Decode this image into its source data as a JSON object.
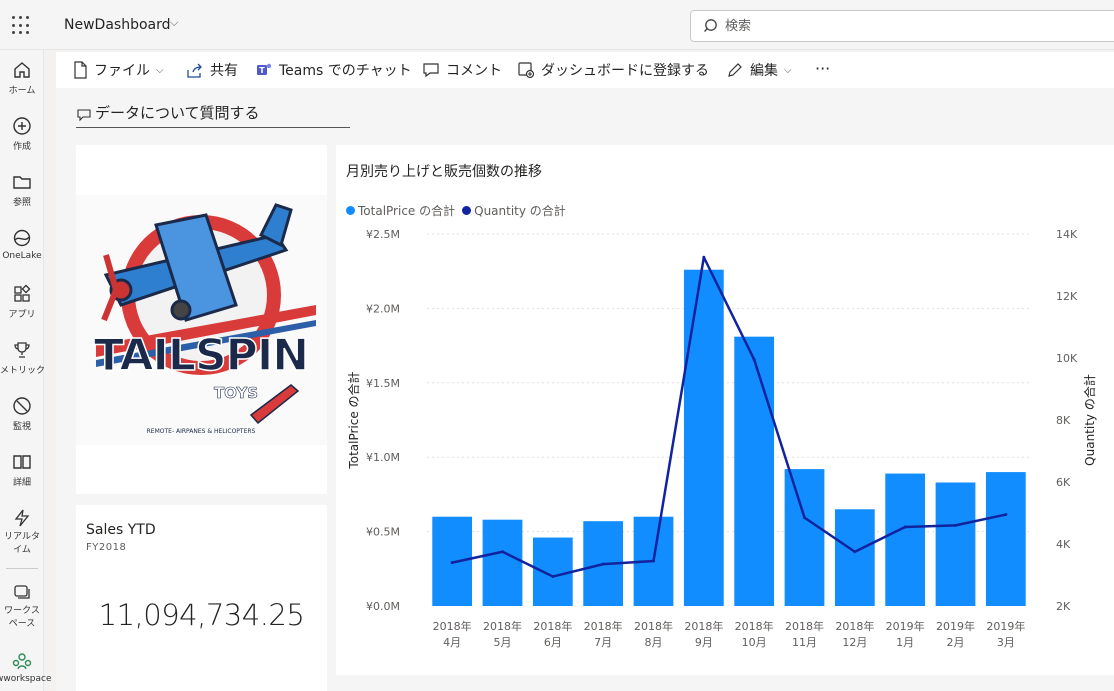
{
  "topbar": {
    "app_name": "NewDashboard",
    "search_placeholder": "検索"
  },
  "leftnav": {
    "items": [
      {
        "label": "ホーム",
        "icon": "home-icon"
      },
      {
        "label": "作成",
        "icon": "create-icon"
      },
      {
        "label": "参照",
        "icon": "browse-icon"
      },
      {
        "label": "OneLake",
        "icon": "onelake-icon"
      },
      {
        "label": "アプリ",
        "icon": "apps-icon"
      },
      {
        "label": "メトリック",
        "icon": "trophy-icon"
      },
      {
        "label": "監視",
        "icon": "monitor-icon"
      },
      {
        "label": "詳細",
        "icon": "learn-icon"
      },
      {
        "label": "リアルタイム",
        "icon": "realtime-icon"
      },
      {
        "label": "ワークスペース",
        "icon": "workspaces-icon"
      },
      {
        "label": "twworkspace",
        "icon": "workspace-group-icon"
      }
    ]
  },
  "toolbar": {
    "file": "ファイル",
    "share": "共有",
    "teams": "Teams でのチャット",
    "comment": "コメント",
    "pin": "ダッシュボードに登録する",
    "edit": "編集",
    "more": "···"
  },
  "qa": {
    "label": "データについて質問する"
  },
  "logo": {
    "text": "TAILSPIN",
    "sub": "TOYS",
    "tagline": "REMOTE-  AIRPANES & HELICOPTERS"
  },
  "ytd": {
    "title": "Sales YTD",
    "subtitle": "FY2018",
    "value": "11,094,734.25"
  },
  "chart": {
    "title": "月別売り上げと販売個数の推移",
    "legend": [
      {
        "name": "TotalPrice の合計",
        "color": "#118DFF"
      },
      {
        "name": "Quantity の合計",
        "color": "#12239E"
      }
    ],
    "y_left_label": "TotalPrice の合計",
    "y_right_label": "Quantity の合計",
    "y_left_ticks": [
      "¥0.0M",
      "¥0.5M",
      "¥1.0M",
      "¥1.5M",
      "¥2.0M",
      "¥2.5M"
    ],
    "y_right_ticks": [
      "2K",
      "4K",
      "6K",
      "8K",
      "10K",
      "12K",
      "14K"
    ]
  },
  "chart_data": {
    "type": "bar",
    "categories": [
      [
        "2018年",
        "4月"
      ],
      [
        "2018年",
        "5月"
      ],
      [
        "2018年",
        "6月"
      ],
      [
        "2018年",
        "7月"
      ],
      [
        "2018年",
        "8月"
      ],
      [
        "2018年",
        "9月"
      ],
      [
        "2018年",
        "10月"
      ],
      [
        "2018年",
        "11月"
      ],
      [
        "2018年",
        "12月"
      ],
      [
        "2019年",
        "1月"
      ],
      [
        "2019年",
        "2月"
      ],
      [
        "2019年",
        "3月"
      ]
    ],
    "series": [
      {
        "name": "TotalPrice の合計",
        "type": "bar",
        "axis": "left",
        "values": [
          0.6,
          0.58,
          0.46,
          0.57,
          0.6,
          2.26,
          1.81,
          0.92,
          0.65,
          0.89,
          0.83,
          0.9
        ]
      },
      {
        "name": "Quantity の合計",
        "type": "line",
        "axis": "right",
        "values": [
          3400,
          3750,
          2950,
          3350,
          3450,
          13250,
          9950,
          4850,
          3750,
          4550,
          4600,
          4950
        ]
      }
    ],
    "ylim_left": [
      0,
      2.5
    ],
    "ylim_right": [
      2000,
      14000
    ],
    "grid": true,
    "legend_position": "top-left"
  }
}
